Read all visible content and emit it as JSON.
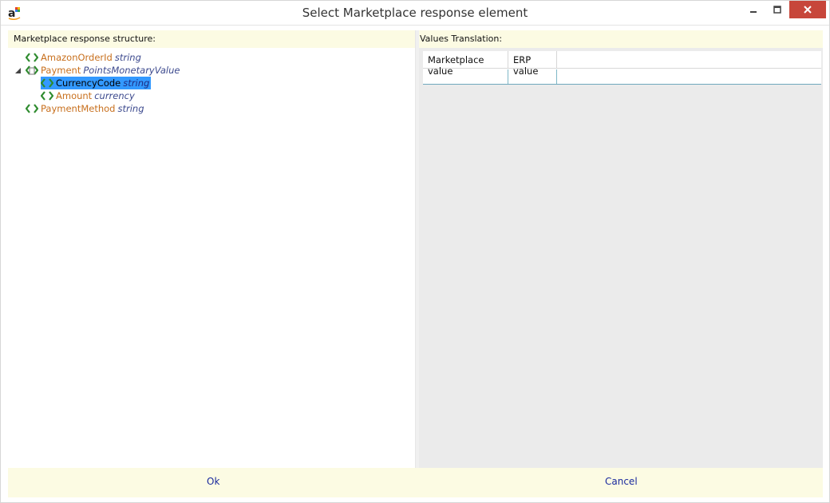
{
  "window": {
    "title": "Select Marketplace response element",
    "controls": {
      "minimize_icon": "minimize-icon",
      "maximize_icon": "maximize-icon",
      "close_icon": "close-icon"
    }
  },
  "left_pane": {
    "label": "Marketplace response structure:",
    "tree": [
      {
        "name": "AmazonOrderId",
        "type": "string",
        "level": 0,
        "selected": false,
        "expander": false
      },
      {
        "name": "Payment",
        "type": "PointsMonetaryValue",
        "level": 0,
        "selected": false,
        "expander": true
      },
      {
        "name": "CurrencyCode",
        "type": "string",
        "level": 1,
        "selected": true,
        "expander": false
      },
      {
        "name": "Amount",
        "type": "currency",
        "level": 1,
        "selected": false,
        "expander": false
      },
      {
        "name": "PaymentMethod",
        "type": "string",
        "level": 0,
        "selected": false,
        "expander": false
      }
    ]
  },
  "right_pane": {
    "label": "Values Translation:",
    "columns": [
      "Marketplace value",
      "ERP value"
    ],
    "rows": []
  },
  "footer": {
    "ok_label": "Ok",
    "cancel_label": "Cancel"
  },
  "colors": {
    "header_bg": "#fcfbe3",
    "element_name": "#c8701e",
    "element_type": "#3d4a8e",
    "selection": "#3399ff",
    "close_button": "#c7463a",
    "link_button": "#1a2a9e"
  }
}
